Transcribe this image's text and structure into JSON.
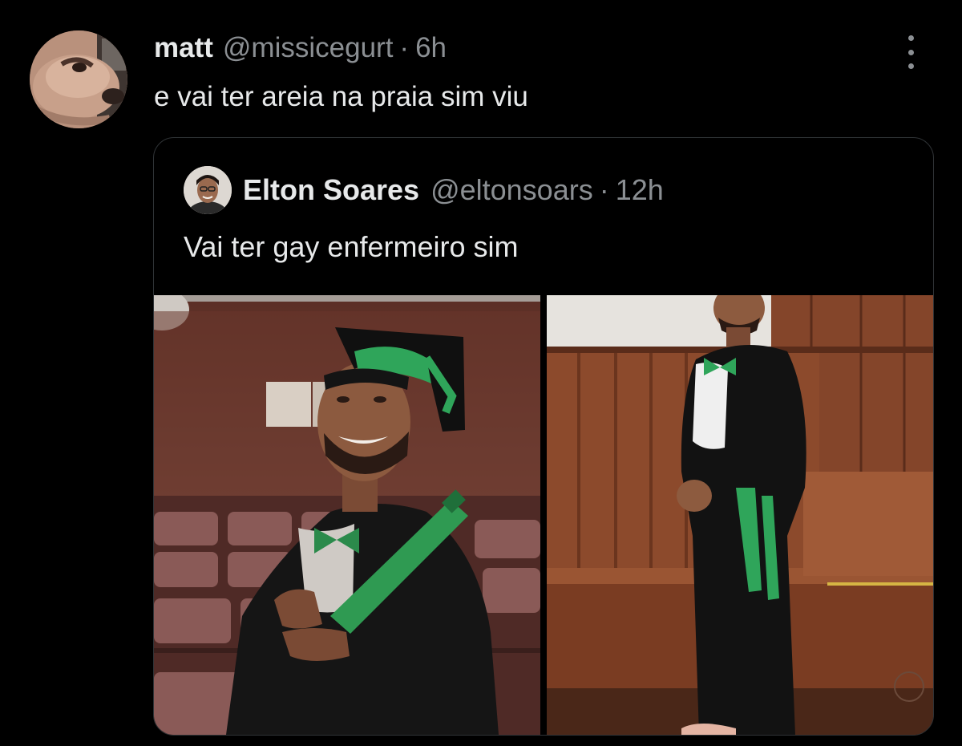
{
  "post": {
    "author": {
      "display_name": "matt",
      "handle": "@missicegurt",
      "separator": "·",
      "time": "6h"
    },
    "text": "e vai ter areia na praia sim viu",
    "more_icon": "more-vertical-icon"
  },
  "quoted_post": {
    "author": {
      "display_name": "Elton Soares",
      "handle": "@eltonsoars",
      "separator": "·",
      "time": "12h"
    },
    "text": "Vai ter gay enfermeiro sim",
    "media": [
      {
        "kind": "photo",
        "subject": "graduate-with-cap-and-diploma"
      },
      {
        "kind": "photo",
        "subject": "graduate-standing-in-gown"
      }
    ]
  },
  "colors": {
    "background": "#000000",
    "primary_text": "#e7e9ea",
    "secondary_text": "#8b8f93",
    "card_border": "#2f3336",
    "accent_green": "#2fa55a"
  }
}
